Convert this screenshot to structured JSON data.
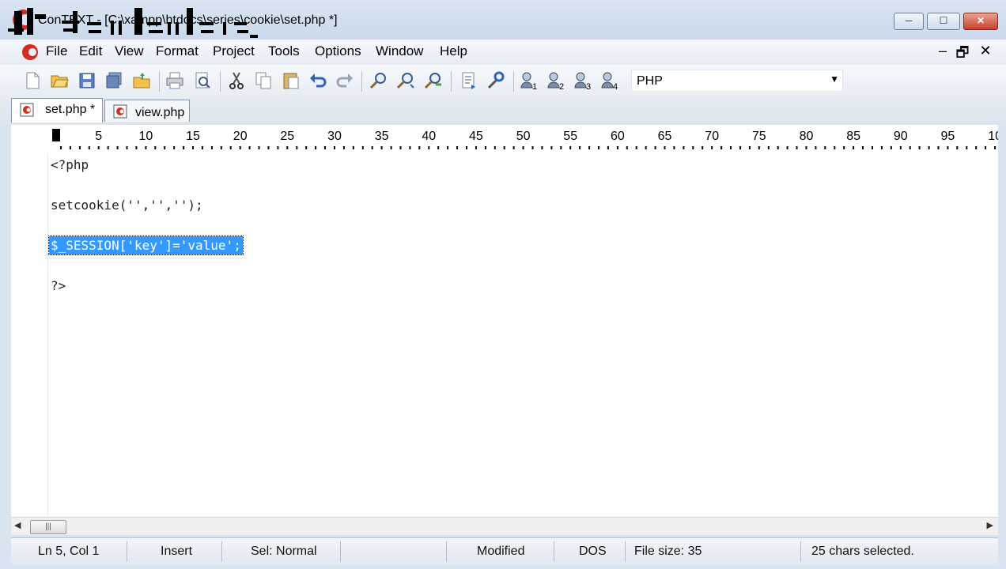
{
  "window": {
    "title": "ConTEXT - [C:\\xampp\\htdocs\\series\\cookie\\set.php *]",
    "min_glyph": "─",
    "max_glyph": "☐",
    "close_glyph": "✕"
  },
  "menu": {
    "items": [
      "File",
      "Edit",
      "View",
      "Format",
      "Project",
      "Tools",
      "Options",
      "Window",
      "Help"
    ],
    "mdi_min": "–",
    "mdi_restore": "🗗",
    "mdi_close": "✕"
  },
  "toolbar": {
    "icons": [
      "new-file-icon",
      "open-folder-icon",
      "save-icon",
      "save-all-icon",
      "open-project-icon",
      "print-icon",
      "print-preview-icon",
      "cut-icon",
      "copy-icon",
      "paste-icon",
      "undo-icon",
      "redo-icon",
      "find-icon",
      "find-next-icon",
      "replace-icon",
      "export-icon",
      "settings-icon",
      "user-command-1-icon",
      "user-command-2-icon",
      "user-command-3-icon",
      "user-command-4-icon"
    ],
    "highlighter": {
      "value": "PHP",
      "arrow": "▼"
    }
  },
  "tabs": [
    {
      "label": "set.php *",
      "active": true
    },
    {
      "label": "view.php",
      "active": false
    }
  ],
  "ruler": {
    "labels": [
      "5",
      "10",
      "15",
      "20",
      "25",
      "30",
      "35",
      "40",
      "45",
      "50",
      "55",
      "60",
      "65",
      "70",
      "75",
      "80",
      "85",
      "90",
      "95",
      "10"
    ]
  },
  "editor": {
    "lines": [
      "<?php",
      "",
      "setcookie('','','');",
      "",
      "$_SESSION['key']='value';",
      "",
      "?>"
    ],
    "selected_line": 4
  },
  "scrollbar": {
    "left_arrow": "◀",
    "right_arrow": "▶",
    "thumb_grip": "|||"
  },
  "status": {
    "position": "Ln 5, Col 1",
    "mode": "Insert",
    "selection_mode": "Sel: Normal",
    "modified": "Modified",
    "line_endings": "DOS",
    "file_size": "File size: 35",
    "selected_chars": "25 chars selected."
  },
  "colors": {
    "selection": "#3399ff",
    "app_red": "#d62b1f",
    "chrome": "#d9e4f1"
  }
}
